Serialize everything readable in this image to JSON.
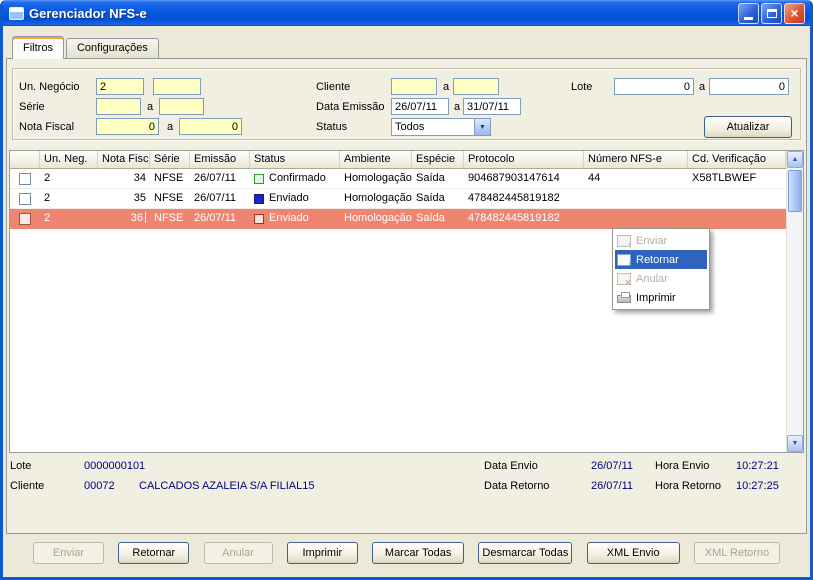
{
  "window": {
    "title": "Gerenciador NFS-e"
  },
  "tabs": [
    {
      "label": "Filtros",
      "active": true
    },
    {
      "label": "Configurações",
      "active": false
    }
  ],
  "filters": {
    "un_negocio_label": "Un. Negócio",
    "un_negocio_from": "2",
    "un_negocio_to": "",
    "serie_label": "Série",
    "serie_from": "",
    "serie_to": "",
    "nota_fiscal_label": "Nota Fiscal",
    "nota_fiscal_from": "0",
    "nota_fiscal_to": "0",
    "cliente_label": "Cliente",
    "cliente_from": "",
    "cliente_to": "",
    "data_emissao_label": "Data Emissão",
    "data_emissao_from": "26/07/11",
    "data_emissao_to": "31/07/11",
    "status_label": "Status",
    "status_value": "Todos",
    "lote_label": "Lote",
    "lote_from": "0",
    "lote_to": "0",
    "range_separator": "a",
    "atualizar_label": "Atualizar"
  },
  "table": {
    "columns": [
      "",
      "Un. Neg.",
      "Nota Fiscal",
      "Série",
      "Emissão",
      "Status",
      "Ambiente",
      "Espécie",
      "Protocolo",
      "Número NFS-e",
      "Cd. Verificação"
    ],
    "selected_row_color": "#ef8570",
    "rows": [
      {
        "selected": false,
        "un_neg": "2",
        "nota_fiscal": "34",
        "serie": "NFSE",
        "emissao": "26/07/11",
        "status": "Confirmado",
        "status_fill": "#dff5df",
        "status_border": "#2e9e2e",
        "ambiente": "Homologação",
        "especie": "Saída",
        "protocolo": "904687903147614",
        "numero_nfse": "44",
        "cd_verificacao": "X58TLBWEF"
      },
      {
        "selected": false,
        "un_neg": "2",
        "nota_fiscal": "35",
        "serie": "NFSE",
        "emissao": "26/07/11",
        "status": "Enviado",
        "status_fill": "#1b24c8",
        "status_border": "#101a8a",
        "ambiente": "Homologação",
        "especie": "Saída",
        "protocolo": "478482445819182",
        "numero_nfse": "",
        "cd_verificacao": ""
      },
      {
        "selected": true,
        "un_neg": "2",
        "nota_fiscal": "36",
        "serie": "NFSE",
        "emissao": "26/07/11",
        "status": "Enviado",
        "status_fill": "#f8ddd6",
        "status_border": "#a03020",
        "ambiente": "Homologação",
        "especie": "Saída",
        "protocolo": "478482445819182",
        "numero_nfse": "",
        "cd_verificacao": ""
      }
    ]
  },
  "context_menu": {
    "items": [
      {
        "label": "Enviar",
        "enabled": false,
        "selected": false,
        "icon": "send-grid"
      },
      {
        "label": "Retornar",
        "enabled": true,
        "selected": true,
        "icon": "return-grid"
      },
      {
        "label": "Anular",
        "enabled": false,
        "selected": false,
        "icon": "cancel-grid"
      },
      {
        "label": "Imprimir",
        "enabled": true,
        "selected": false,
        "icon": "print"
      }
    ],
    "highlight_color": "#2f63c0"
  },
  "footer": {
    "lote_label": "Lote",
    "lote_value": "0000000101",
    "cliente_label": "Cliente",
    "cliente_code": "00072",
    "cliente_name": "CALCADOS AZALEIA S/A FILIAL15",
    "data_envio_label": "Data Envio",
    "data_envio_value": "26/07/11",
    "hora_envio_label": "Hora Envio",
    "hora_envio_value": "10:27:21",
    "data_retorno_label": "Data Retorno",
    "data_retorno_value": "26/07/11",
    "hora_retorno_label": "Hora Retorno",
    "hora_retorno_value": "10:27:25"
  },
  "actions": [
    {
      "label": "Enviar",
      "enabled": false
    },
    {
      "label": "Retornar",
      "enabled": true
    },
    {
      "label": "Anular",
      "enabled": false
    },
    {
      "label": "Imprimir",
      "enabled": true
    },
    {
      "label": "Marcar Todas",
      "enabled": true
    },
    {
      "label": "Desmarcar Todas",
      "enabled": true
    },
    {
      "label": "XML Envio",
      "enabled": true
    },
    {
      "label": "XML Retorno",
      "enabled": false
    }
  ]
}
